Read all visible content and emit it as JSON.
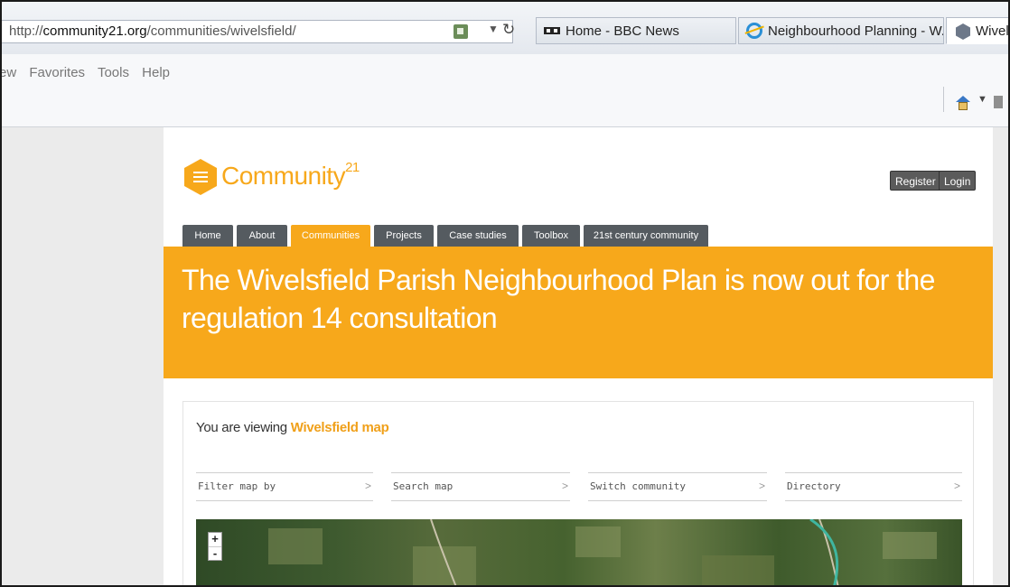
{
  "browser": {
    "url_prefix": "http://",
    "url_domain": "community21.org",
    "url_path": "/communities/wivelsfield/",
    "tabs": [
      {
        "label": "Home - BBC News",
        "icon": "bbc-favicon-icon"
      },
      {
        "label": "Neighbourhood Planning - W...",
        "icon": "ie-favicon-icon"
      },
      {
        "label": "Wivelsf",
        "icon": "hexagon-favicon-icon"
      }
    ],
    "menu": [
      "ew",
      "Favorites",
      "Tools",
      "Help"
    ]
  },
  "site": {
    "brand": "Community",
    "brand_sup": "21",
    "register_label": "Register",
    "login_label": "Login",
    "nav": [
      {
        "label": "Home",
        "active": false
      },
      {
        "label": "About",
        "active": false
      },
      {
        "label": "Communities",
        "active": true
      },
      {
        "label": "Projects",
        "active": false
      },
      {
        "label": "Case studies",
        "active": false
      },
      {
        "label": "Toolbox",
        "active": false
      },
      {
        "label": "21st century community",
        "active": false
      }
    ],
    "banner_title": "The Wivelsfield Parish Neighbourhood Plan is now out for the regulation 14 consultation",
    "viewing_prefix": "You are viewing",
    "viewing_name": "Wivelsfield map",
    "filters": [
      {
        "label": "Filter map by",
        "chevron": ">"
      },
      {
        "label": "Search map",
        "chevron": ">"
      },
      {
        "label": "Switch community",
        "chevron": ">"
      },
      {
        "label": "Directory",
        "chevron": ">"
      }
    ],
    "zoom_in": "+",
    "zoom_out": "-"
  },
  "colors": {
    "accent": "#f7a81b",
    "nav_dark": "#555b60",
    "page_bg": "#ebebeb"
  }
}
